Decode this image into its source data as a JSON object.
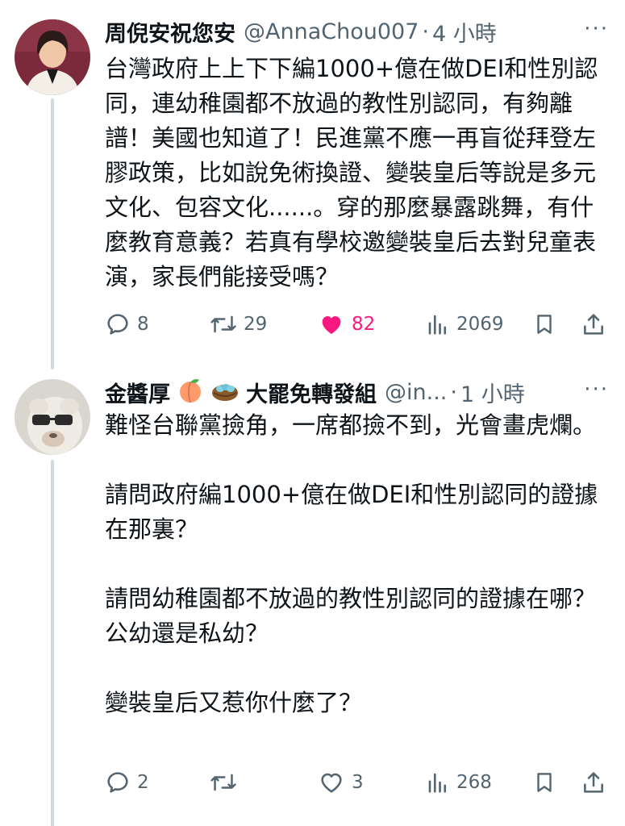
{
  "tweets": [
    {
      "author": "周倪安祝您安",
      "handle": "@AnnaChou007",
      "separator": "·",
      "time": "4 小時",
      "text": "台灣政府上上下下編1000+億在做DEI和性別認同，連幼稚園都不放過的教性別認同，有夠離譜！美國也知道了！民進黨不應一再盲從拜登左膠政策，比如說免術換證、變裝皇后等說是多元文化、包容文化......。穿的那麼暴露跳舞，有什麼教育意義？若真有學校邀變裝皇后去對兒童表演，家長們能接受嗎？",
      "replies": "8",
      "retweets": "29",
      "likes": "82",
      "liked": true,
      "views": "2069"
    },
    {
      "author": "金醬厚",
      "author_suffix": "大罷免轉發組",
      "handle": "@in...",
      "separator": "·",
      "time": "1 小時",
      "text": "難怪台聯黨撿角，一席都撿不到，光會畫虎爛。\n\n請問政府編1000+億在做DEI和性別認同的證據在那裏？\n\n請問幼稚園都不放過的教性別認同的證據在哪？公幼還是私幼？\n\n變裝皇后又惹你什麼了？",
      "replies": "2",
      "retweets": "",
      "likes": "3",
      "liked": false,
      "views": "268"
    }
  ],
  "icons": {
    "more": "more-icon",
    "reply": "reply-icon",
    "retweet": "retweet-icon",
    "like": "heart-icon",
    "views": "views-icon",
    "bookmark": "bookmark-icon",
    "share": "share-icon",
    "peach": "peach-emoji",
    "nest": "nest-with-eggs-emoji"
  },
  "colors": {
    "text": "#0f1419",
    "secondary": "#536471",
    "like": "#f91880",
    "thread_line": "#cfd9de"
  },
  "more_label": "···"
}
